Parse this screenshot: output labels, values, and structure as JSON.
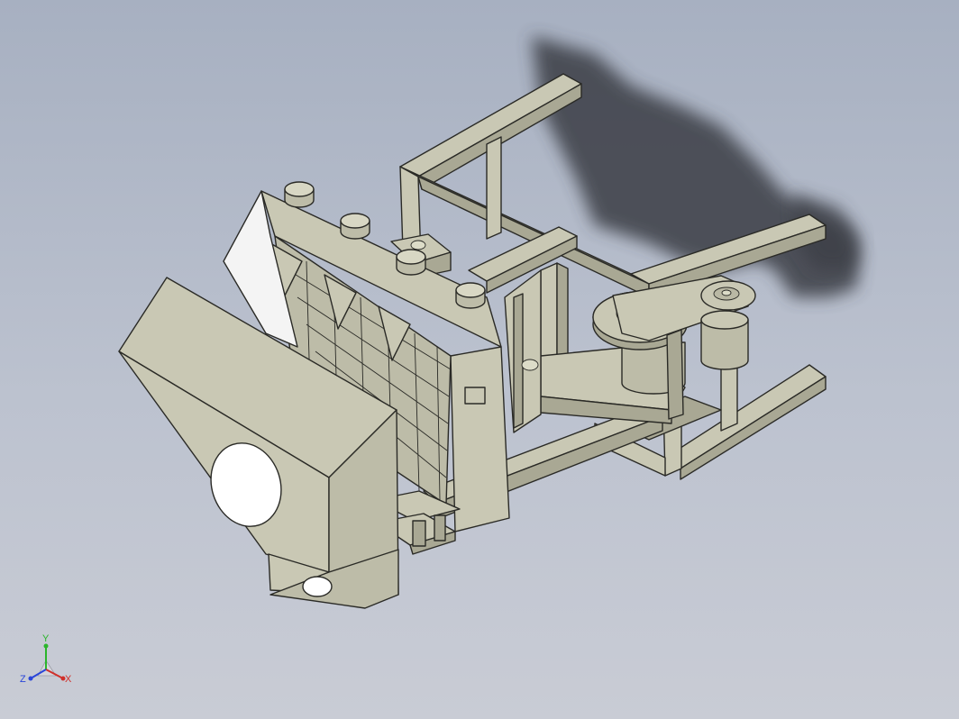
{
  "viewport": {
    "background_top": "#a7b0c1",
    "background_bottom": "#c9ccd5",
    "part_color": "#c9c8b4",
    "part_shade": "#a9a894",
    "part_dark": "#8f8e7c",
    "shadow_color": "#3a3e44"
  },
  "triad": {
    "x_label": "X",
    "y_label": "Y",
    "z_label": "Z",
    "x_color": "#d0302a",
    "y_color": "#2bb52b",
    "z_color": "#2a45d8"
  }
}
